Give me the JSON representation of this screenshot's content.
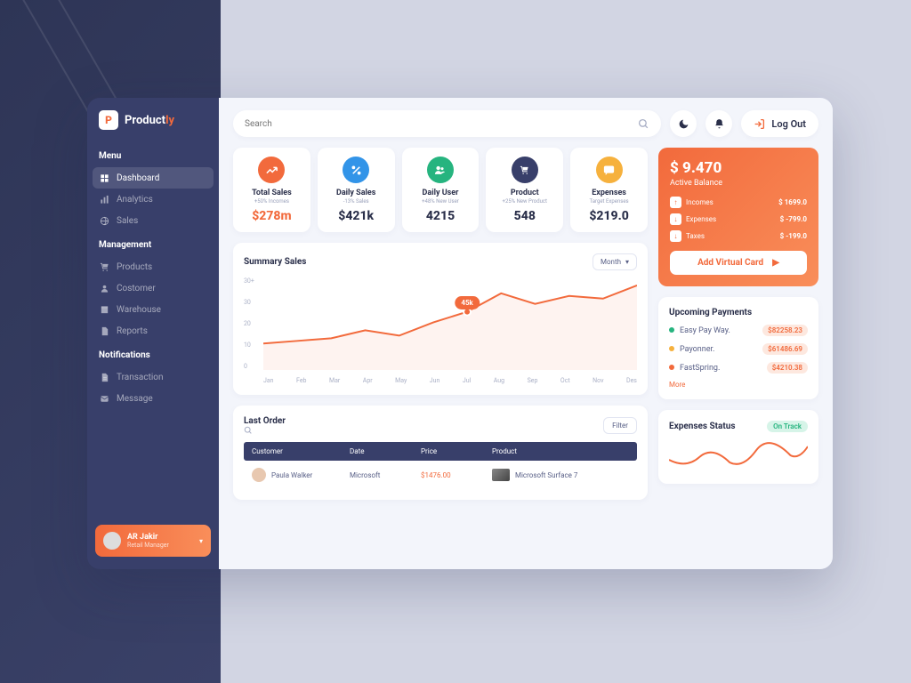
{
  "brand": {
    "name": "Product",
    "suffix": "ly",
    "logo_letter": "P"
  },
  "sidebar": {
    "sections": [
      {
        "title": "Menu",
        "items": [
          {
            "label": "Dashboard",
            "icon": "grid-icon",
            "active": true
          },
          {
            "label": "Analytics",
            "icon": "bar-icon"
          },
          {
            "label": "Sales",
            "icon": "globe-icon"
          }
        ]
      },
      {
        "title": "Management",
        "items": [
          {
            "label": "Products",
            "icon": "cart-icon"
          },
          {
            "label": "Costomer",
            "icon": "user-icon"
          },
          {
            "label": "Warehouse",
            "icon": "box-icon"
          },
          {
            "label": "Reports",
            "icon": "doc-icon"
          }
        ]
      },
      {
        "title": "Notifications",
        "items": [
          {
            "label": "Transaction",
            "icon": "file-icon"
          },
          {
            "label": "Message",
            "icon": "mail-icon"
          }
        ]
      }
    ]
  },
  "user": {
    "name": "AR Jakir",
    "role": "Retail Manager"
  },
  "search": {
    "placeholder": "Search"
  },
  "logout": {
    "label": "Log Out"
  },
  "kpis": [
    {
      "title": "Total Sales",
      "sub": "+50% Incomes",
      "value": "$278m",
      "color": "#f26a3c",
      "val_dark": false,
      "icon": "trend-icon"
    },
    {
      "title": "Daily Sales",
      "sub": "-13% Sales",
      "value": "$421k",
      "color": "#3294e8",
      "val_dark": true,
      "icon": "percent-icon"
    },
    {
      "title": "Daily User",
      "sub": "+48% New User",
      "value": "4215",
      "color": "#26b47f",
      "val_dark": true,
      "icon": "users-icon"
    },
    {
      "title": "Product",
      "sub": "+25% New Product",
      "value": "548",
      "color": "#383f6a",
      "val_dark": true,
      "icon": "cart-icon"
    },
    {
      "title": "Expenses",
      "sub": "Target Expenses",
      "value": "$219.0",
      "color": "#f6b13d",
      "val_dark": true,
      "icon": "chat-icon"
    }
  ],
  "summary": {
    "title": "Summary Sales",
    "dropdown": "Month",
    "peak_label": "45k"
  },
  "chart_data": {
    "type": "line",
    "title": "Summary Sales",
    "ylabel": "",
    "xlabel": "",
    "ylim": [
      0,
      35
    ],
    "y_ticks": [
      "30+",
      "30",
      "20",
      "10",
      "0"
    ],
    "categories": [
      "Jan",
      "Feb",
      "Mar",
      "Apr",
      "May",
      "Jun",
      "Jul",
      "Aug",
      "Sep",
      "Oct",
      "Nov",
      "Des"
    ],
    "values": [
      10,
      11,
      12,
      15,
      13,
      18,
      22,
      29,
      25,
      28,
      27,
      32
    ],
    "highlight": {
      "index": 6,
      "label": "45k"
    }
  },
  "balance": {
    "amount": "$ 9.470",
    "label": "Active Balance",
    "rows": [
      {
        "label": "Incomes",
        "value": "$ 1699.0",
        "icon": "up-icon"
      },
      {
        "label": "Expenses",
        "value": "$ -799.0",
        "icon": "down-icon"
      },
      {
        "label": "Taxes",
        "value": "$ -199.0",
        "icon": "down-icon"
      }
    ],
    "cta": "Add Virtual Card"
  },
  "upcoming": {
    "title": "Upcoming Payments",
    "rows": [
      {
        "label": "Easy Pay Way.",
        "amount": "$82258.23",
        "dot": "#26b47f",
        "pill": "#fde8df",
        "pill_text": "#f26a3c"
      },
      {
        "label": "Payonner.",
        "amount": "$61486.69",
        "dot": "#f6b13d",
        "pill": "#fde8df",
        "pill_text": "#f26a3c"
      },
      {
        "label": "FastSpring.",
        "amount": "$4210.38",
        "dot": "#f26a3c",
        "pill": "#fde8df",
        "pill_text": "#f26a3c"
      }
    ],
    "more": "More"
  },
  "orders": {
    "title": "Last Order",
    "filter": "Filter",
    "columns": {
      "customer": "Customer",
      "date": "Date",
      "price": "Price",
      "product": "Product"
    },
    "rows": [
      {
        "customer": "Paula Walker",
        "date": "Microsoft",
        "price": "$1476.00",
        "product": "Microsoft Surface 7"
      }
    ]
  },
  "expenses_status": {
    "title": "Expenses Status",
    "badge": "On Track"
  }
}
